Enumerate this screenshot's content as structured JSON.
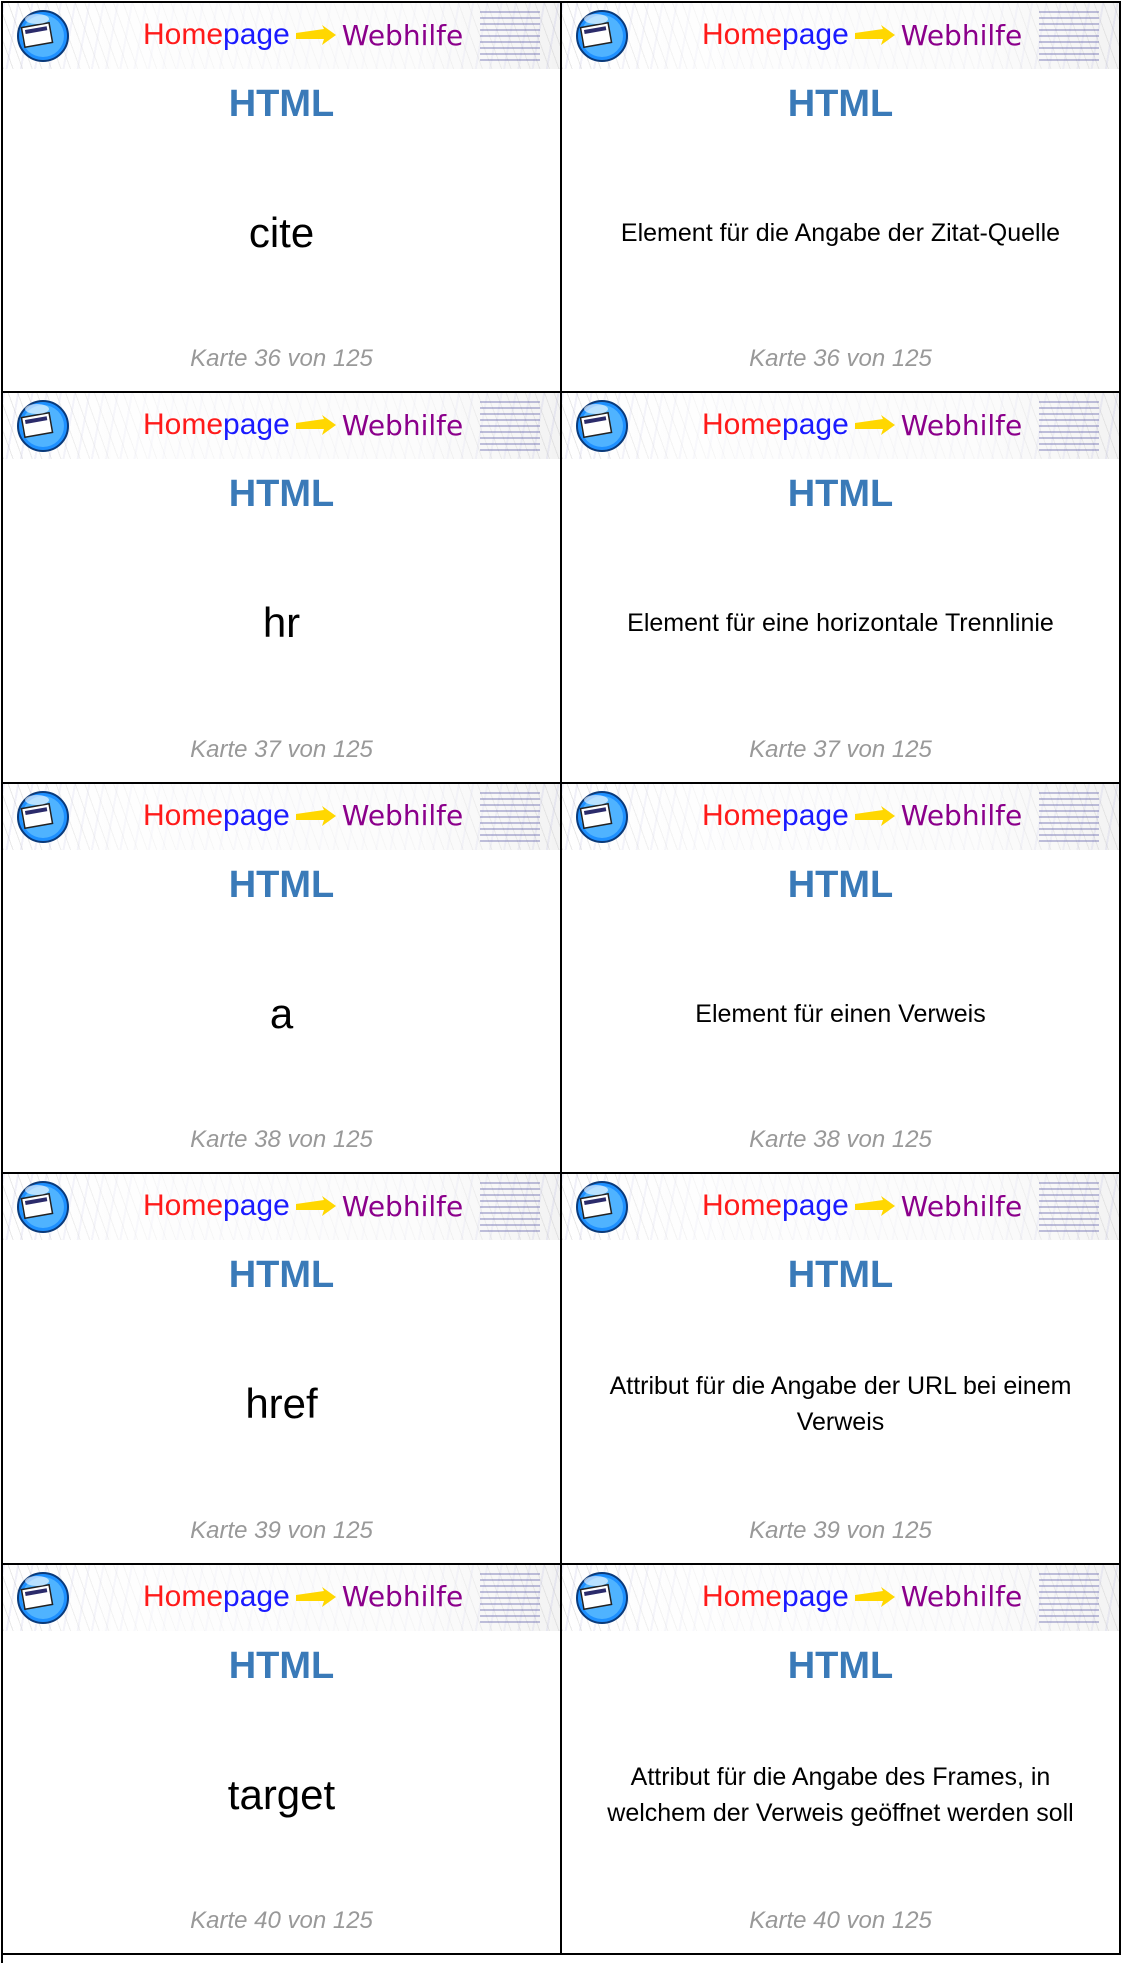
{
  "brand": {
    "part1": "Home",
    "part2": "page",
    "part3": "Webhilfe"
  },
  "subject": "HTML",
  "rows": [
    {
      "front": "cite",
      "back": "Element für die Angabe der Zitat-Quelle",
      "footer": "Karte 36 von 125"
    },
    {
      "front": "hr",
      "back": "Element für eine horizontale Trennlinie",
      "footer": "Karte 37 von 125"
    },
    {
      "front": "a",
      "back": "Element für einen Verweis",
      "footer": "Karte 38 von 125"
    },
    {
      "front": "href",
      "back": "Attribut für die Angabe der URL bei einem Verweis",
      "footer": "Karte 39 von 125"
    },
    {
      "front": "target",
      "back": "Attribut für die Angabe des Frames, in welchem der Verweis geöffnet werden soll",
      "footer": "Karte 40 von 125"
    }
  ]
}
